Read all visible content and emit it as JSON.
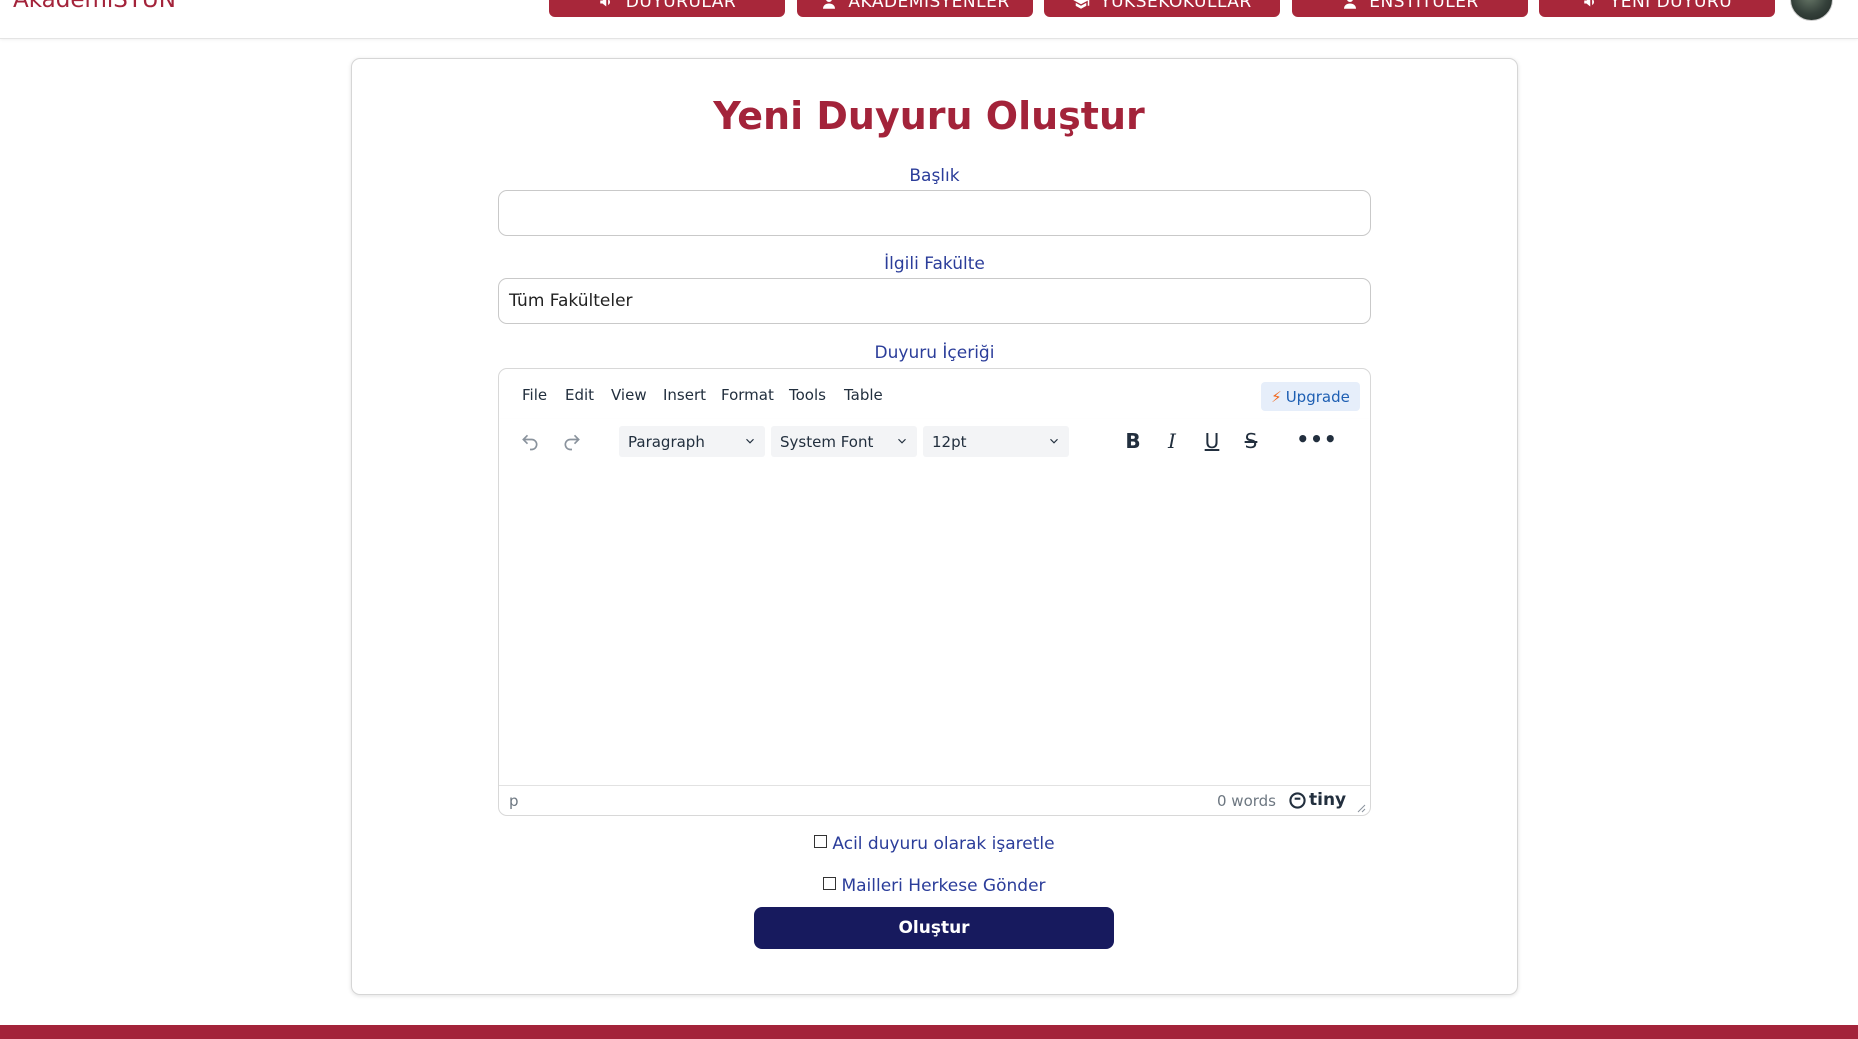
{
  "header": {
    "brand": "AkademiSTUN",
    "nav": [
      {
        "label": "DUYURULAR",
        "icon": "megaphone-icon"
      },
      {
        "label": "AKADEMİSYENLER",
        "icon": "user-icon"
      },
      {
        "label": "YÜKSEKOKULLAR",
        "icon": "school-icon"
      },
      {
        "label": "ENSTİTÜLER",
        "icon": "user-icon"
      },
      {
        "label": "YENİ DUYURU",
        "icon": "megaphone-icon"
      }
    ]
  },
  "form": {
    "title": "Yeni Duyuru Oluştur",
    "title_label": "Başlık",
    "title_value": "",
    "faculty_label": "İlgili Fakülte",
    "faculty_value": "Tüm Fakülteler",
    "content_label": "Duyuru İçeriği",
    "urgent_label": "Acil duyuru olarak işaretle",
    "urgent_checked": false,
    "mail_label": "Mailleri Herkese Gönder",
    "mail_checked": false,
    "submit_label": "Oluştur"
  },
  "editor": {
    "menu": [
      "File",
      "Edit",
      "View",
      "Insert",
      "Format",
      "Tools",
      "Table"
    ],
    "upgrade_label": "Upgrade",
    "block_format": "Paragraph",
    "font_family": "System Font",
    "font_size": "12pt",
    "status_path": "p",
    "word_count": "0 words",
    "brand": "tiny"
  },
  "colors": {
    "brand_red": "#a3233a",
    "submit_navy": "#171a5e",
    "label_blue": "#2b3d9a"
  }
}
